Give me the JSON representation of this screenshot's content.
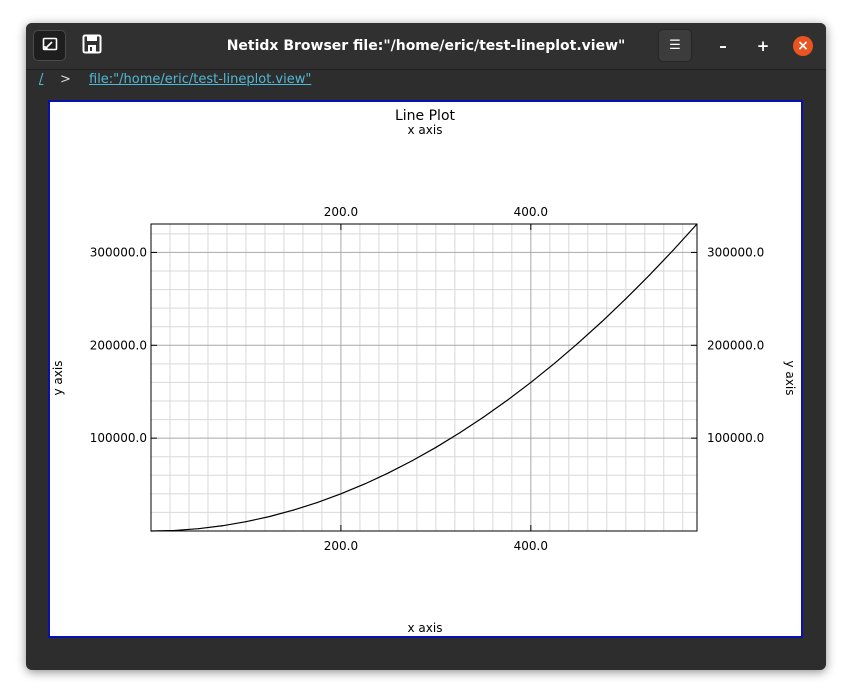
{
  "window": {
    "title": "Netidx Browser file:\"/home/eric/test-lineplot.view\"",
    "icons": {
      "design_mode": "edit-mode-icon",
      "save": "floppy-disk-icon",
      "menu": "hamburger-menu-icon",
      "minimize": "minimize-icon",
      "maximize": "maximize-icon",
      "close": "close-icon"
    },
    "controls": {
      "minimize": "–",
      "maximize": "+",
      "close": "×",
      "menu": "☰"
    },
    "colors": {
      "titlebar": "#303030",
      "body": "#2d2d2d",
      "link": "#4fb8d4",
      "close": "#e95420",
      "plot_border": "#0a10b0"
    }
  },
  "breadcrumb": {
    "root": "/",
    "separator": ">",
    "path": "file:\"/home/eric/test-lineplot.view\""
  },
  "chart_data": {
    "type": "line",
    "title": "Line Plot",
    "xlabel": "x axis",
    "ylabel": "y axis",
    "xlim": [
      0,
      575
    ],
    "ylim": [
      0,
      330625
    ],
    "x_ticks": [
      200,
      400
    ],
    "x_tick_labels": [
      "200.0",
      "400.0"
    ],
    "y_ticks": [
      100000,
      200000,
      300000
    ],
    "y_tick_labels": [
      "100000.0",
      "200000.0",
      "300000.0"
    ],
    "grid": true,
    "mirrored_axes": true,
    "series": [
      {
        "color": "#000000",
        "x": [
          0,
          25,
          50,
          75,
          100,
          125,
          150,
          175,
          200,
          225,
          250,
          275,
          300,
          325,
          350,
          375,
          400,
          425,
          450,
          475,
          500,
          525,
          550,
          575
        ],
        "y": [
          0,
          625,
          2500,
          5625,
          10000,
          15625,
          22500,
          30625,
          40000,
          50625,
          62500,
          75625,
          90000,
          105625,
          122500,
          140625,
          160000,
          180625,
          202500,
          225625,
          250000,
          275625,
          302500,
          330625
        ]
      }
    ]
  }
}
